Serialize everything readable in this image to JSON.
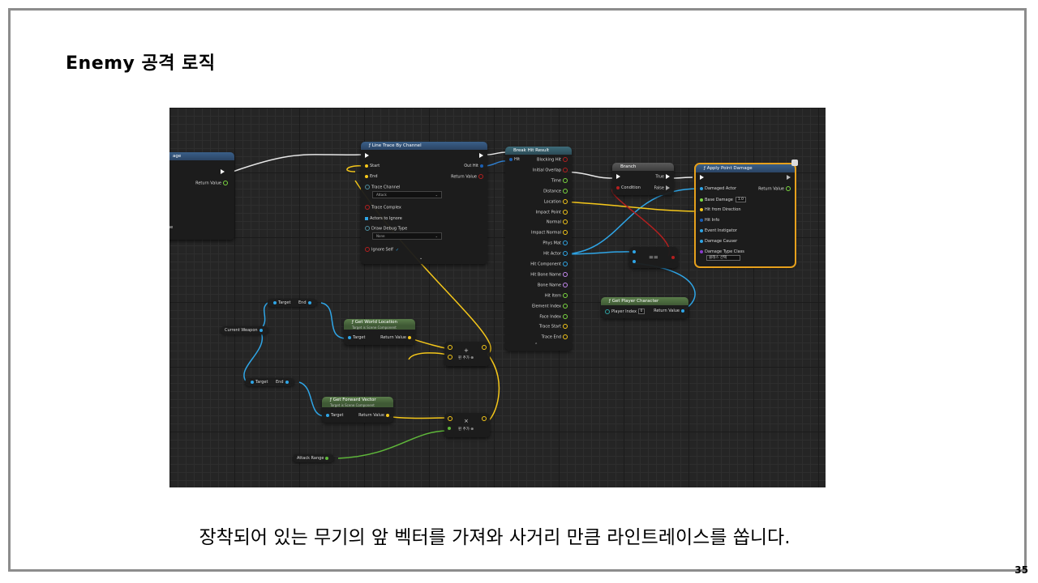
{
  "slide": {
    "title": "Enemy 공격 로직",
    "caption": "장착되어 있는 무기의 앞 벡터를 가져와 사거리 만큼 라인트레이스를 쏩니다.",
    "page_number": "35"
  },
  "colors": {
    "exec": "#ffffff",
    "vector": "#f5c71a",
    "object": "#2fa5e6",
    "bool": "#b41f1f",
    "float": "#7cd941",
    "struct": "#1a5fb4",
    "selection": "#e6a01c"
  },
  "nodes": {
    "partial_left": {
      "title": "age",
      "return_label": "Return Value",
      "label_ne": "ne"
    },
    "line_trace": {
      "title": "Line Trace By Channel",
      "start": "Start",
      "end": "End",
      "trace_channel_label": "Trace Channel",
      "trace_channel_value": "Attack",
      "trace_complex": "Trace Complex",
      "actors_to_ignore": "Actors to Ignore",
      "draw_debug_label": "Draw Debug Type",
      "draw_debug_value": "None",
      "ignore_self": "Ignore Self",
      "out_hit": "Out Hit",
      "return_value": "Return Value"
    },
    "break_hit": {
      "title": "Break Hit Result",
      "input": "Hit",
      "outputs": [
        "Blocking Hit",
        "Initial Overlap",
        "Time",
        "Distance",
        "Location",
        "Impact Point",
        "Normal",
        "Impact Normal",
        "Phys Mat",
        "Hit Actor",
        "Hit Component",
        "Hit Bone Name",
        "Bone Name",
        "Hit Item",
        "Element Index",
        "Face Index",
        "Trace Start",
        "Trace End"
      ]
    },
    "branch": {
      "title": "Branch",
      "condition": "Condition",
      "true_label": "True",
      "false_label": "False"
    },
    "apply_damage": {
      "title": "Apply Point Damage",
      "inputs": [
        "Damaged Actor",
        "Base Damage",
        "Hit from Direction",
        "Hit Info",
        "Event Instigator",
        "Damage Causer",
        "Damage Type Class"
      ],
      "base_damage_value": "1.0",
      "damage_type_value": "클래스 선택",
      "return_value": "Return Value"
    },
    "equals": {
      "label": "=="
    },
    "get_player": {
      "title": "Get Player Character",
      "player_index": "Player Index",
      "player_index_value": "0",
      "return_value": "Return Value"
    },
    "break_top": {
      "target": "Target",
      "end": "End"
    },
    "current_weapon": {
      "label": "Current Weapon"
    },
    "get_world_location": {
      "title": "Get World Location",
      "subtitle": "Target is Scene Component",
      "target": "Target",
      "return_value": "Return Value"
    },
    "add_node": {
      "op": "+",
      "add_pin": "핀 추가"
    },
    "break_bottom": {
      "target": "Target",
      "end": "End"
    },
    "get_forward_vector": {
      "title": "Get Forward Vector",
      "subtitle": "Target is Scene Component",
      "target": "Target",
      "return_value": "Return Value"
    },
    "multiply_node": {
      "op": "×",
      "add_pin": "핀 추가"
    },
    "attack_range": {
      "label": "Attack Range"
    }
  }
}
